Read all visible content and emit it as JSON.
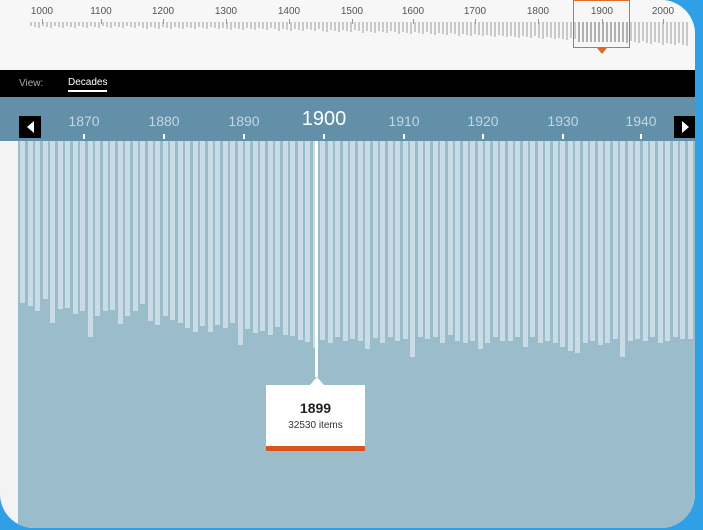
{
  "overview": {
    "labels": [
      "1000",
      "1100",
      "1200",
      "1300",
      "1400",
      "1500",
      "1600",
      "1700",
      "1800",
      "1900",
      "2000"
    ],
    "selected_decade": "1900"
  },
  "view": {
    "label": "View:",
    "option": "Decades"
  },
  "decades": {
    "labels": [
      "1870",
      "1880",
      "1890",
      "1900",
      "1910",
      "1920",
      "1930",
      "1940"
    ],
    "active": "1900"
  },
  "tooltip": {
    "year": "1899",
    "count": "32530 items"
  },
  "colors": {
    "accent": "#d9531e",
    "decade_strip": "#6190a8",
    "histogram_bg": "#9bbccb",
    "bar": "#c9dce5"
  }
}
